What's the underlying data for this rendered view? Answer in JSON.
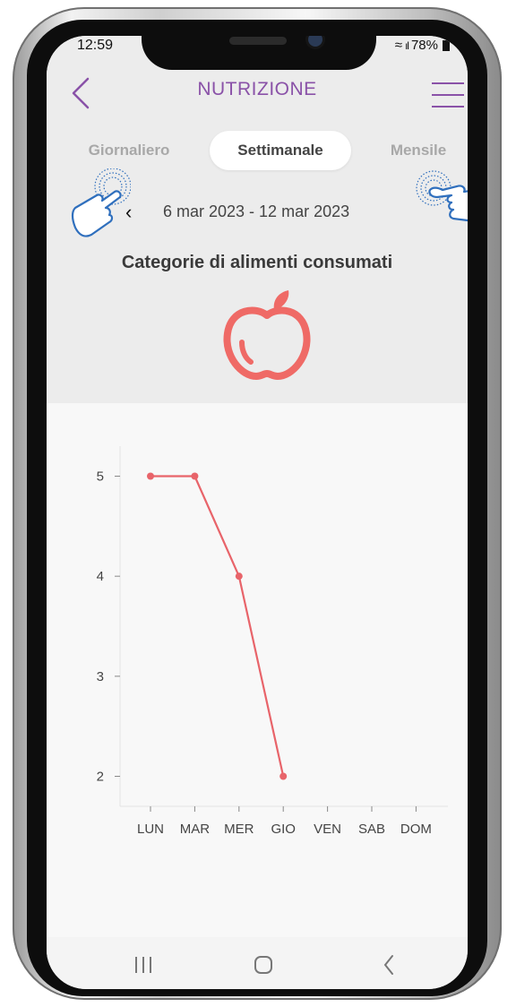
{
  "status_bar": {
    "time": "12:59",
    "battery": "78%"
  },
  "header": {
    "title": "NUTRIZIONE"
  },
  "tabs": [
    {
      "label": "Giornaliero",
      "active": false
    },
    {
      "label": "Settimanale",
      "active": true
    },
    {
      "label": "Mensile",
      "active": false
    }
  ],
  "date_range": "6 mar 2023 - 12 mar 2023",
  "section_title": "Categorie di alimenti consumati",
  "icons": [
    "back-arrow-icon",
    "hamburger-menu-icon",
    "chevron-left-icon",
    "swipe-hand-icon",
    "apple-icon"
  ],
  "colors": {
    "accent": "#8a52a8",
    "line": "#e8646a",
    "hand": "#2f6fbd"
  },
  "chart_data": {
    "type": "line",
    "categories": [
      "LUN",
      "MAR",
      "MER",
      "GIO",
      "VEN",
      "SAB",
      "DOM"
    ],
    "series": [
      {
        "values": [
          5,
          5,
          4,
          2,
          null,
          null,
          null
        ]
      }
    ],
    "yticks": [
      "2",
      "3",
      "4",
      "5"
    ],
    "ylim": [
      1.7,
      5.3
    ],
    "grid": false
  }
}
